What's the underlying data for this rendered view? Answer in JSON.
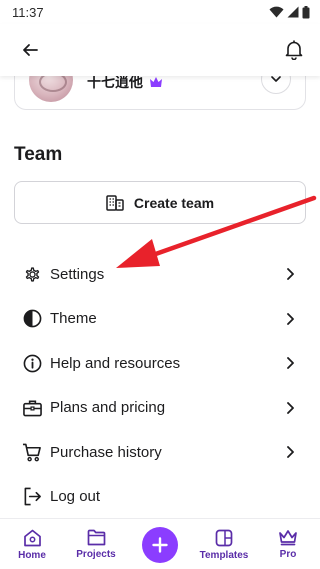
{
  "status_bar": {
    "time": "11:37"
  },
  "profile": {
    "name": "十七逍他"
  },
  "team": {
    "title": "Team",
    "create_label": "Create team"
  },
  "menu": [
    {
      "label": "Settings",
      "icon": "gear-icon"
    },
    {
      "label": "Theme",
      "icon": "theme-icon"
    },
    {
      "label": "Help and resources",
      "icon": "info-icon"
    },
    {
      "label": "Plans and pricing",
      "icon": "briefcase-icon"
    },
    {
      "label": "Purchase history",
      "icon": "cart-icon"
    },
    {
      "label": "Log out",
      "icon": "logout-icon"
    }
  ],
  "bottom_nav": [
    {
      "label": "Home",
      "icon": "home-icon"
    },
    {
      "label": "Projects",
      "icon": "folder-icon"
    },
    {
      "label": "",
      "icon": "plus-icon"
    },
    {
      "label": "Templates",
      "icon": "templates-icon"
    },
    {
      "label": "Pro",
      "icon": "crown-icon"
    }
  ],
  "colors": {
    "accent": "#8b3dff",
    "nav_label": "#5a2da8",
    "annotation": "#e8222b"
  }
}
